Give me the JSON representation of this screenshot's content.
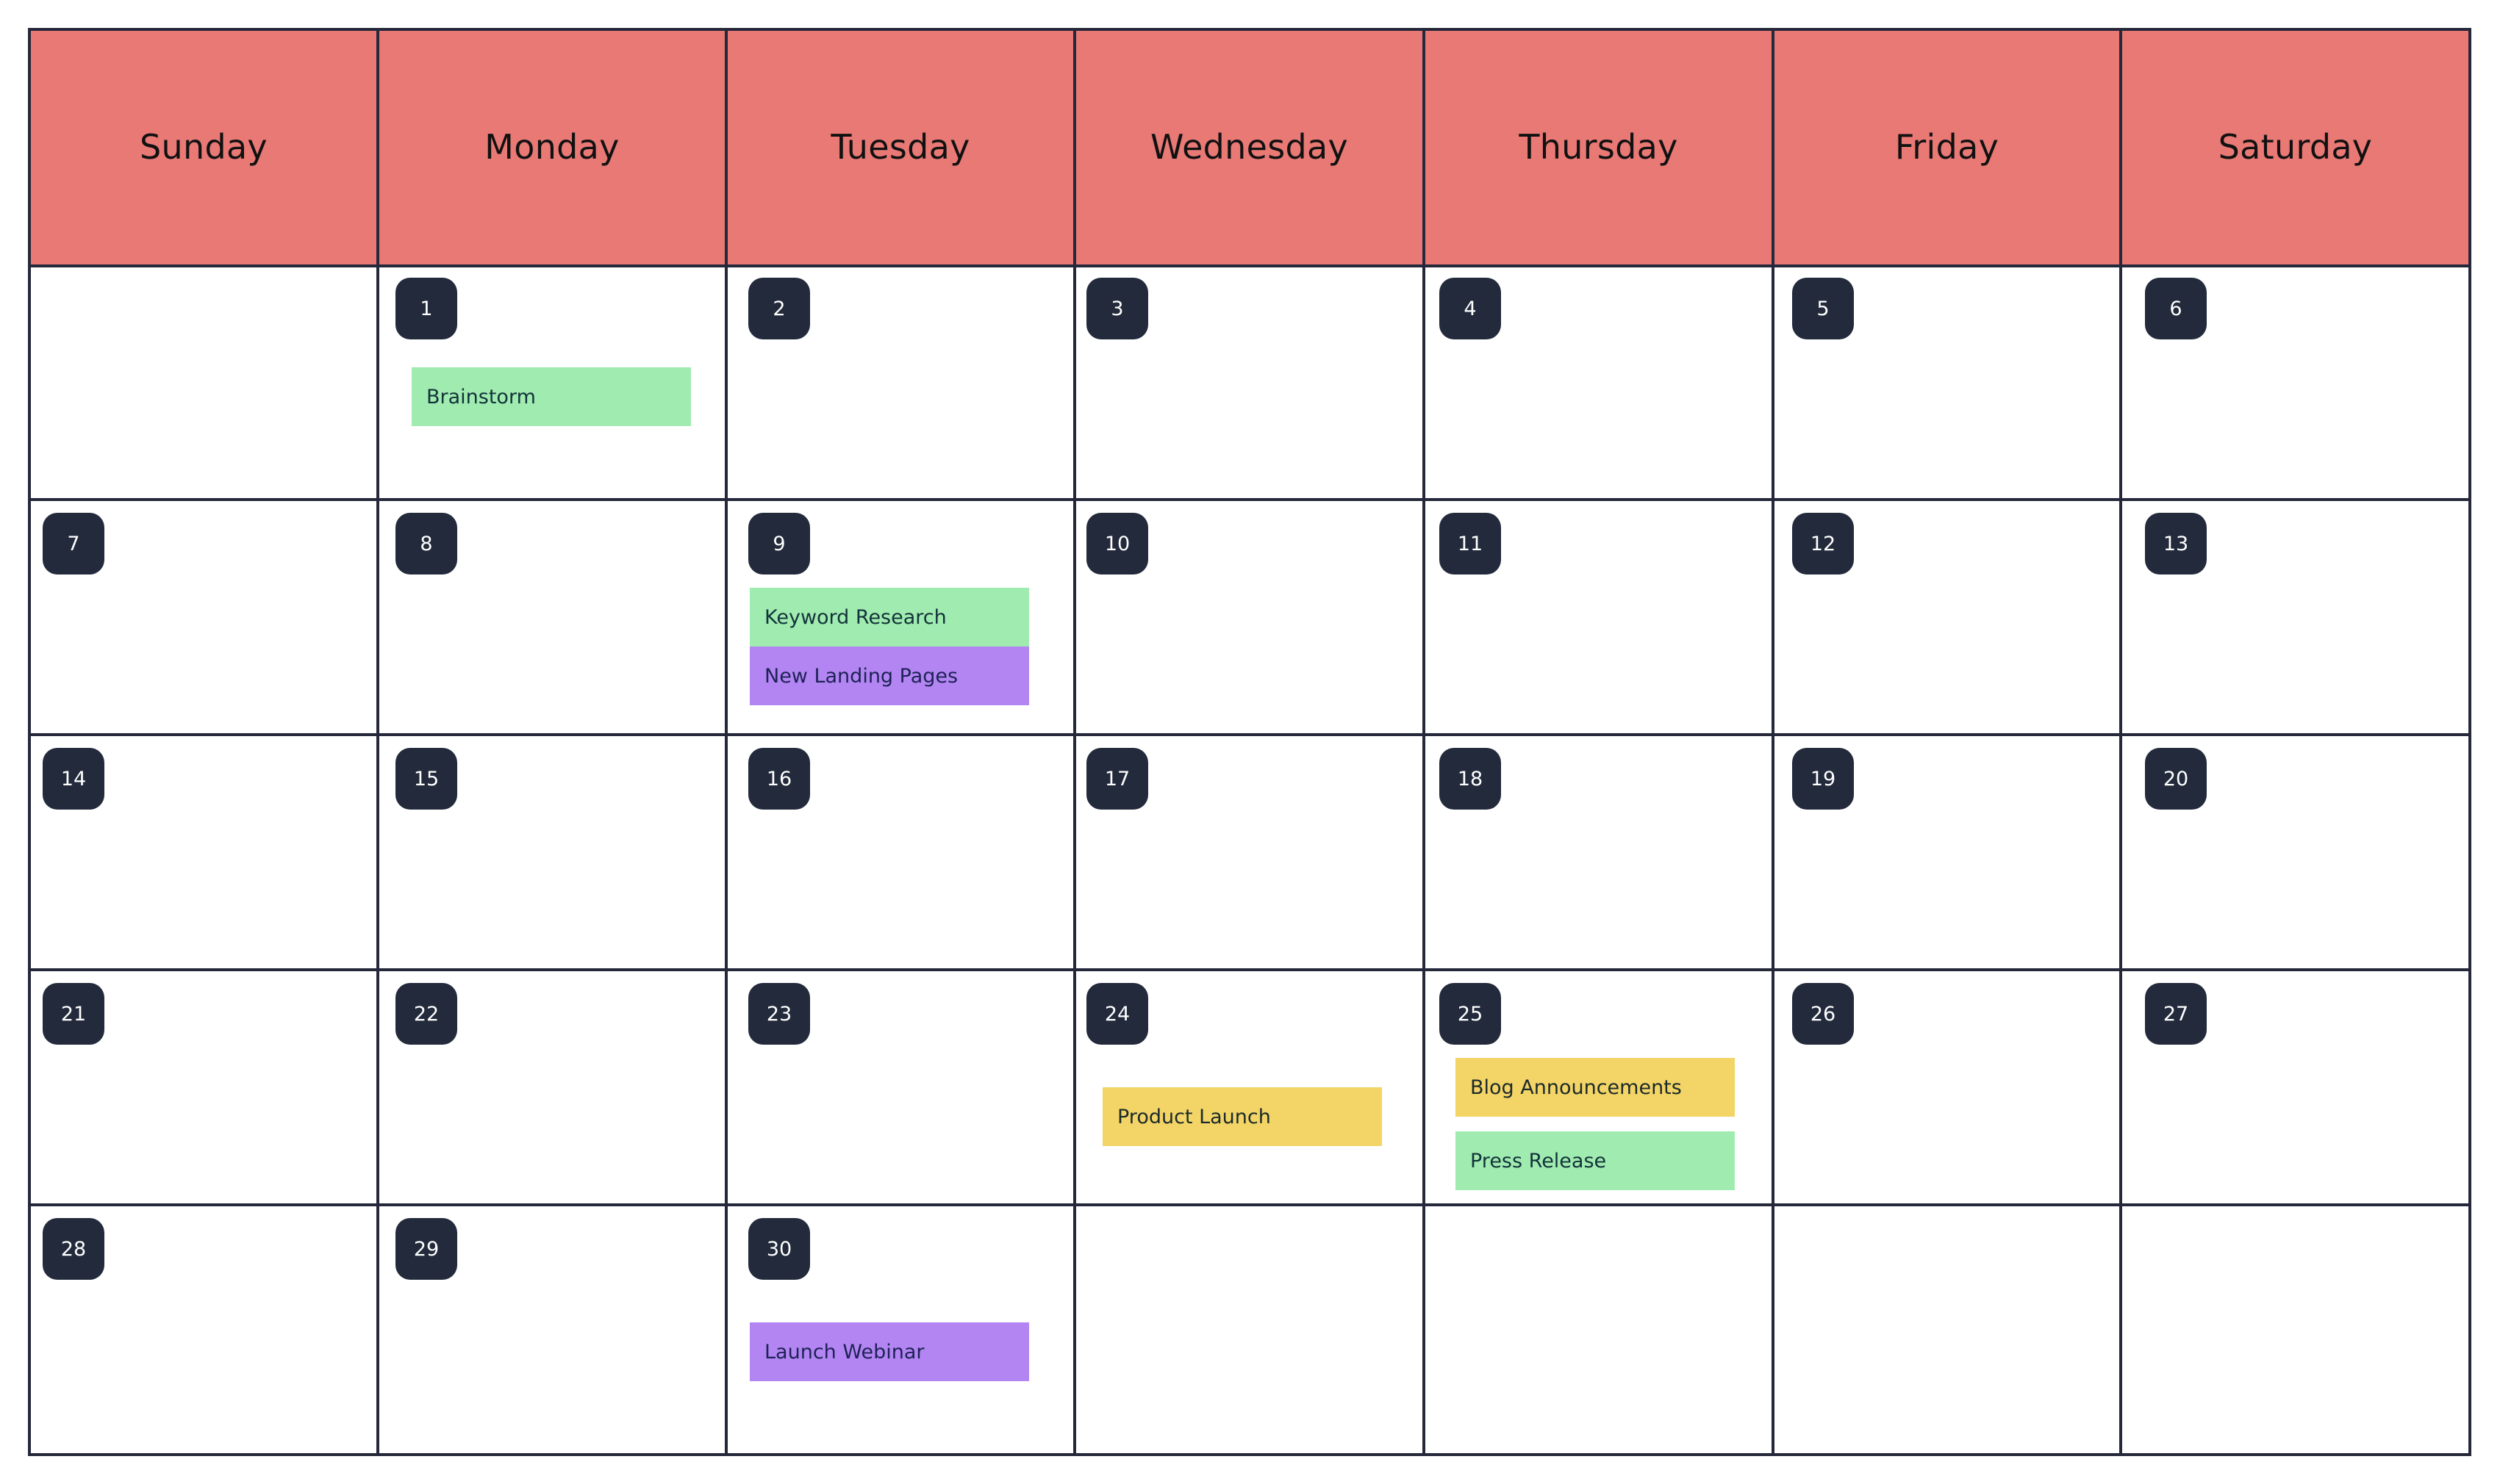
{
  "calendar": {
    "colors": {
      "header_bg": "#e87975",
      "grid_line": "#25283a",
      "badge_bg": "#222a3b",
      "badge_text": "#ffffff",
      "event_green": "#a0ebb0",
      "event_purple": "#b385f2",
      "event_yellow": "#f3d466"
    },
    "weekdays": [
      "Sunday",
      "Monday",
      "Tuesday",
      "Wednesday",
      "Thursday",
      "Friday",
      "Saturday"
    ],
    "weeks": [
      [
        null,
        "1",
        "2",
        "3",
        "4",
        "5",
        "6"
      ],
      [
        "7",
        "8",
        "9",
        "10",
        "11",
        "12",
        "13"
      ],
      [
        "14",
        "15",
        "16",
        "17",
        "18",
        "19",
        "20"
      ],
      [
        "21",
        "22",
        "23",
        "24",
        "25",
        "26",
        "27"
      ],
      [
        "28",
        "29",
        "30",
        null,
        null,
        null,
        null
      ]
    ],
    "events": [
      {
        "day": "1",
        "label": "Brainstorm",
        "color": "green"
      },
      {
        "day": "9",
        "label": "Keyword Research",
        "color": "green"
      },
      {
        "day": "9",
        "label": "New Landing Pages",
        "color": "purple"
      },
      {
        "day": "24",
        "label": "Product Launch",
        "color": "yellow"
      },
      {
        "day": "25",
        "label": "Blog Announcements",
        "color": "yellow"
      },
      {
        "day": "25",
        "label": "Press Release",
        "color": "green"
      },
      {
        "day": "30",
        "label": "Launch Webinar",
        "color": "purple"
      }
    ]
  }
}
